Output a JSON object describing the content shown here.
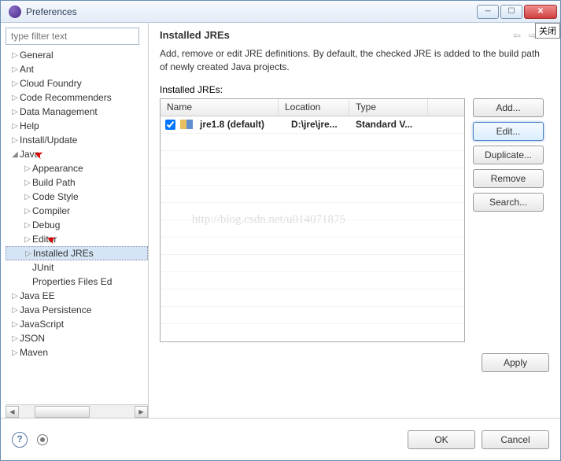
{
  "window": {
    "title": "Preferences",
    "title_tooltip": "关闭"
  },
  "sidebar": {
    "filter_placeholder": "type filter text",
    "items": [
      {
        "label": "General",
        "lvl": 1,
        "tw": "▷"
      },
      {
        "label": "Ant",
        "lvl": 1,
        "tw": "▷"
      },
      {
        "label": "Cloud Foundry",
        "lvl": 1,
        "tw": "▷"
      },
      {
        "label": "Code Recommenders",
        "lvl": 1,
        "tw": "▷"
      },
      {
        "label": "Data Management",
        "lvl": 1,
        "tw": "▷"
      },
      {
        "label": "Help",
        "lvl": 1,
        "tw": "▷"
      },
      {
        "label": "Install/Update",
        "lvl": 1,
        "tw": "▷"
      },
      {
        "label": "Java",
        "lvl": 1,
        "tw": "◢",
        "arrow": true
      },
      {
        "label": "Appearance",
        "lvl": 2,
        "tw": "▷"
      },
      {
        "label": "Build Path",
        "lvl": 2,
        "tw": "▷"
      },
      {
        "label": "Code Style",
        "lvl": 2,
        "tw": "▷"
      },
      {
        "label": "Compiler",
        "lvl": 2,
        "tw": "▷"
      },
      {
        "label": "Debug",
        "lvl": 2,
        "tw": "▷"
      },
      {
        "label": "Editor",
        "lvl": 2,
        "tw": "▷",
        "arrow": true
      },
      {
        "label": "Installed JREs",
        "lvl": 2,
        "tw": "▷",
        "sel": true
      },
      {
        "label": "JUnit",
        "lvl": 2,
        "tw": ""
      },
      {
        "label": "Properties Files Ed",
        "lvl": 2,
        "tw": ""
      },
      {
        "label": "Java EE",
        "lvl": 1,
        "tw": "▷"
      },
      {
        "label": "Java Persistence",
        "lvl": 1,
        "tw": "▷"
      },
      {
        "label": "JavaScript",
        "lvl": 1,
        "tw": "▷"
      },
      {
        "label": "JSON",
        "lvl": 1,
        "tw": "▷"
      },
      {
        "label": "Maven",
        "lvl": 1,
        "tw": "▷"
      }
    ]
  },
  "page": {
    "heading": "Installed JREs",
    "description": "Add, remove or edit JRE definitions. By default, the checked JRE is added to the build path of newly created Java projects.",
    "table_label": "Installed JREs:",
    "columns": {
      "name": "Name",
      "location": "Location",
      "type": "Type"
    },
    "rows": [
      {
        "checked": true,
        "name": "jre1.8 (default)",
        "location": "D:\\jre\\jre...",
        "type": "Standard V..."
      }
    ],
    "watermark": "http://blog.csdn.net/u014071875",
    "buttons": {
      "add": "Add...",
      "edit": "Edit...",
      "duplicate": "Duplicate...",
      "remove": "Remove",
      "search": "Search..."
    },
    "apply": "Apply"
  },
  "footer": {
    "ok": "OK",
    "cancel": "Cancel"
  }
}
